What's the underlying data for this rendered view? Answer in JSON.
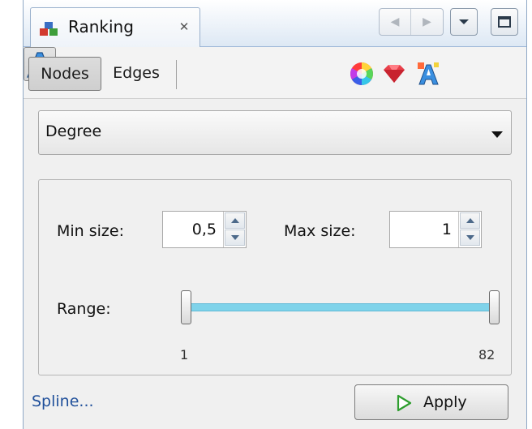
{
  "tab": {
    "title": "Ranking",
    "close_glyph": "✕",
    "icon": "ranking-icon"
  },
  "window_controls": {
    "nav_left": "◀",
    "nav_right": "▶"
  },
  "toolbar": {
    "element_tabs": [
      {
        "label": "Nodes",
        "selected": true
      },
      {
        "label": "Edges",
        "selected": false
      }
    ],
    "transformers": [
      "color-wheel-icon",
      "size-gem-icon",
      "label-color-icon",
      "label-size-icon"
    ],
    "selected_transformer": "label-size-icon"
  },
  "ranking_attribute": {
    "value": "Degree"
  },
  "settings": {
    "min_size_label": "Min size:",
    "min_size_value": "0,5",
    "max_size_label": "Max size:",
    "max_size_value": "1",
    "range_label": "Range:",
    "range_min": "1",
    "range_max": "82"
  },
  "footer": {
    "spline_link": "Spline...",
    "apply_label": "Apply"
  },
  "colors": {
    "slider_fill": "#7fd3ea",
    "link": "#1f4f9a",
    "apply_icon": "#2e9e2e"
  }
}
